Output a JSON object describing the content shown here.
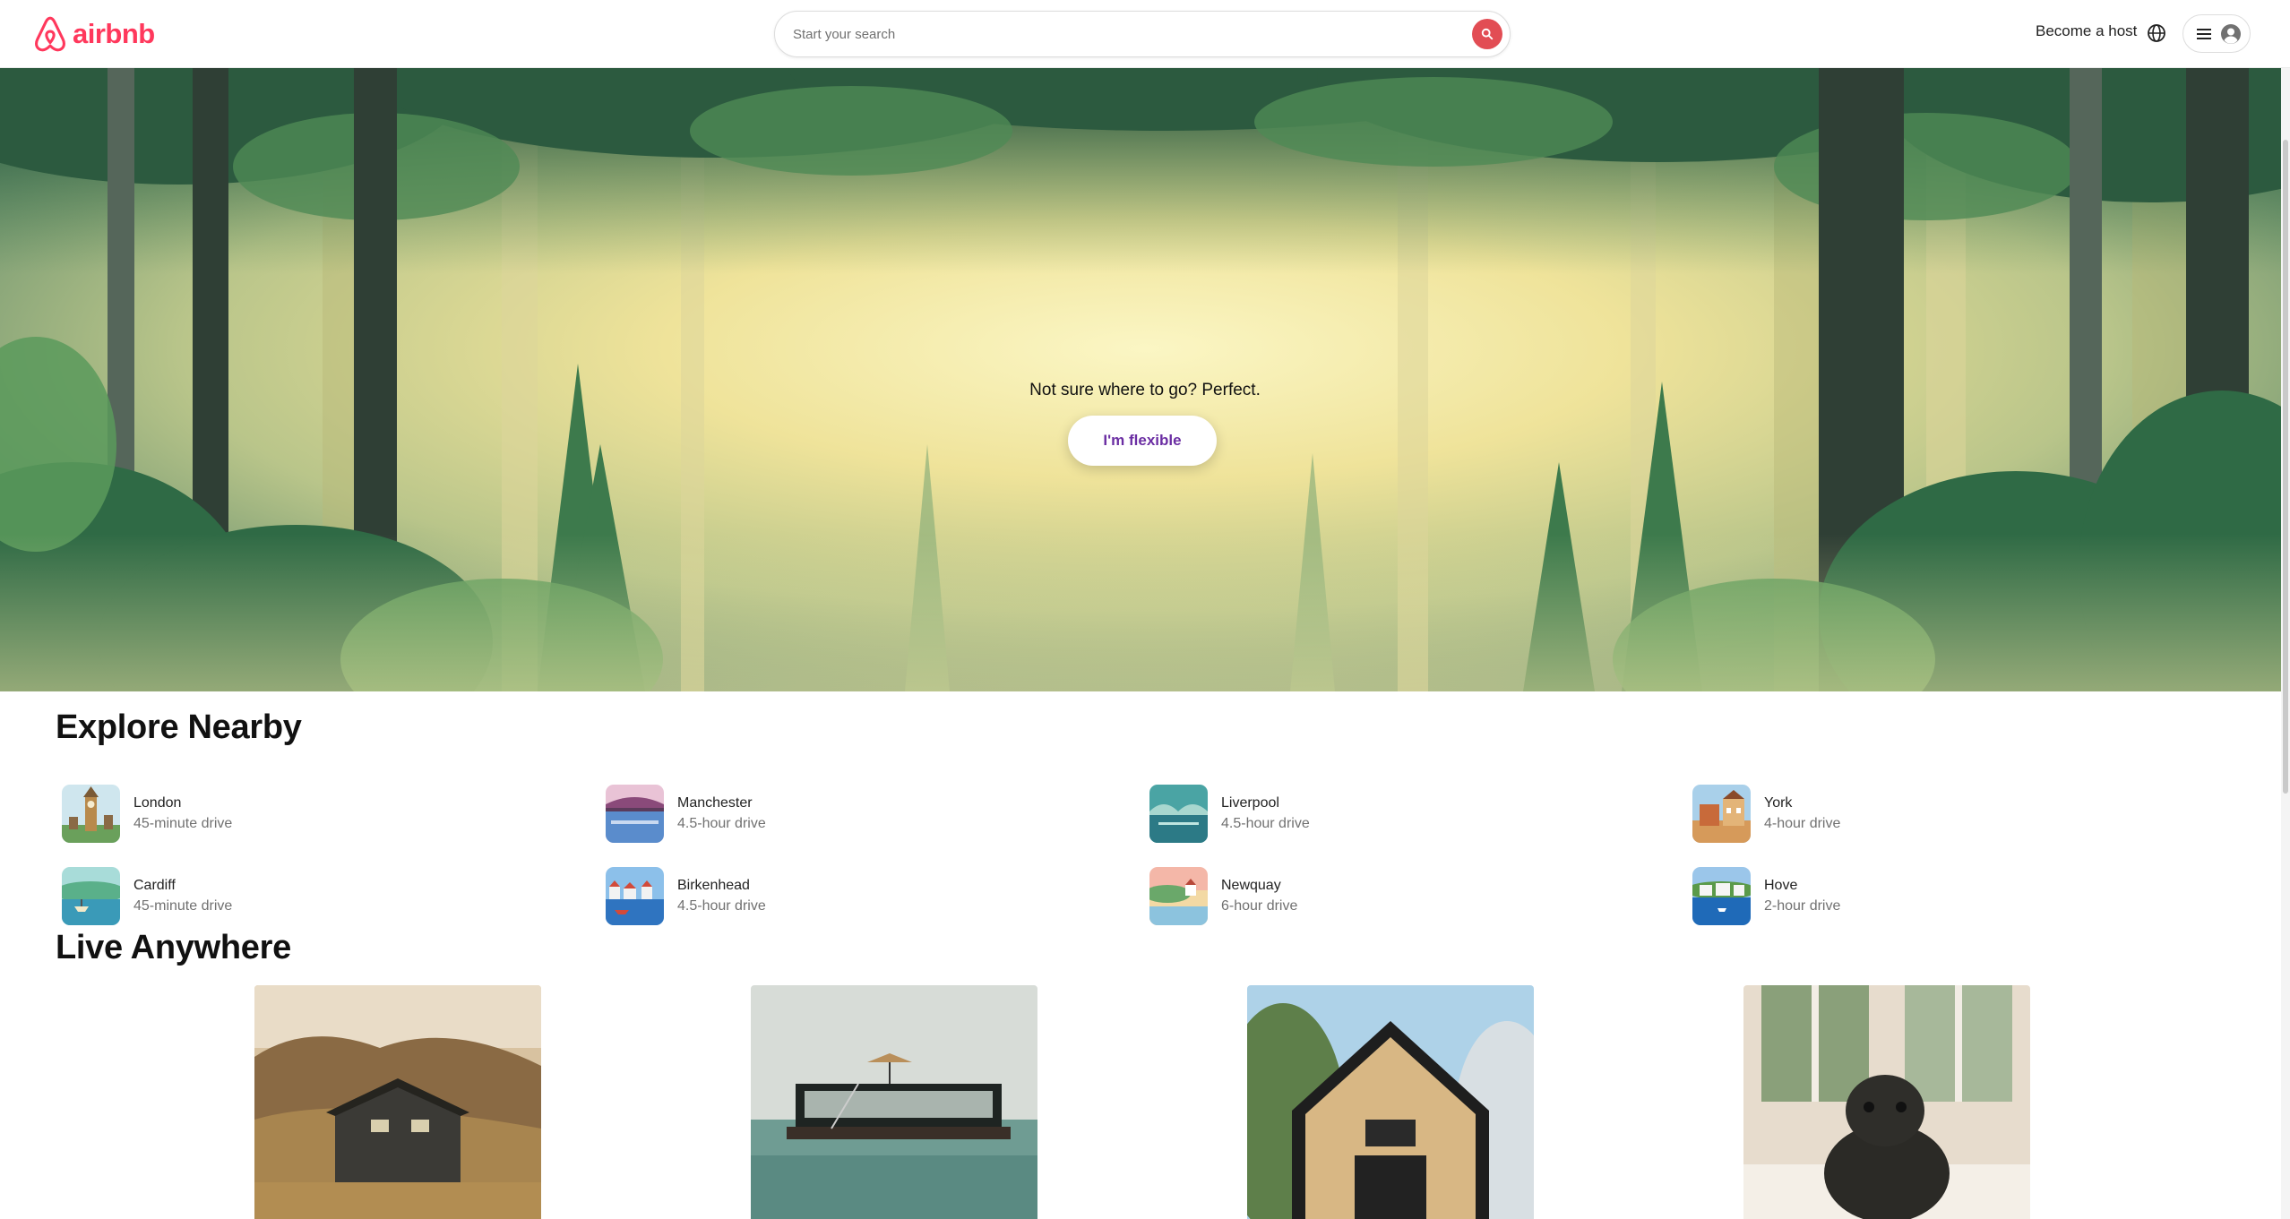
{
  "header": {
    "logo_text": "airbnb",
    "search_placeholder": "Start your search",
    "become_host": "Become a host",
    "brand_color": "#ff385c",
    "search_button_color": "#e24d54"
  },
  "hero": {
    "tagline": "Not sure where to go? Perfect.",
    "button_label": "I'm flexible",
    "button_text_color": "#6b2ea3"
  },
  "explore": {
    "title": "Explore Nearby",
    "items": [
      {
        "city": "London",
        "drive": "45-minute drive"
      },
      {
        "city": "Manchester",
        "drive": "4.5-hour drive"
      },
      {
        "city": "Liverpool",
        "drive": "4.5-hour drive"
      },
      {
        "city": "York",
        "drive": "4-hour drive"
      },
      {
        "city": "Cardiff",
        "drive": "45-minute drive"
      },
      {
        "city": "Birkenhead",
        "drive": "4.5-hour drive"
      },
      {
        "city": "Newquay",
        "drive": "6-hour drive"
      },
      {
        "city": "Hove",
        "drive": "2-hour drive"
      }
    ]
  },
  "live": {
    "title": "Live Anywhere"
  },
  "icons": [
    "airbnb-logo-icon",
    "search-icon",
    "globe-icon",
    "menu-icon",
    "user-avatar-icon"
  ]
}
